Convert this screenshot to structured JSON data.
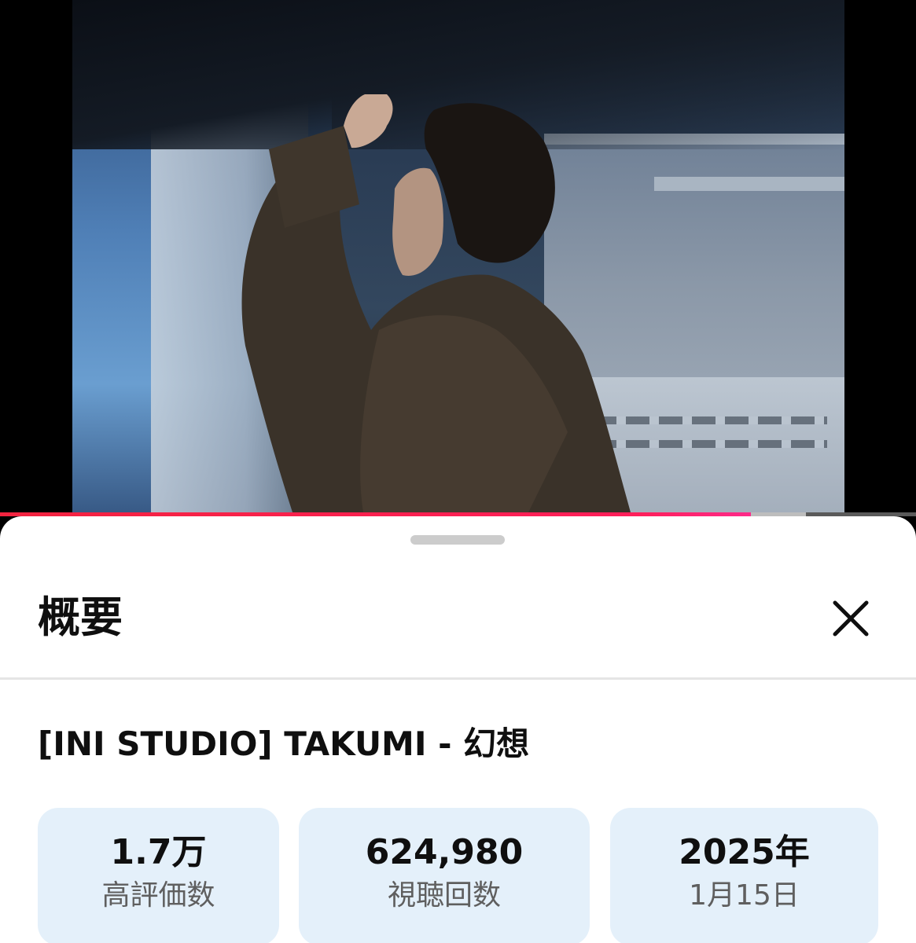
{
  "player": {
    "progress_fraction": 0.82,
    "buffered_fraction": 0.88,
    "progress_colors": [
      "#f2233f",
      "#ff2a8a"
    ]
  },
  "sheet": {
    "title": "概要",
    "close_icon": "close-icon",
    "video_title": "[INI STUDIO] TAKUMI - 幻想",
    "stats": [
      {
        "value": "1.7万",
        "label": "高評価数"
      },
      {
        "value": "624,980",
        "label": "視聴回数"
      },
      {
        "value": "2025年",
        "label": "1月15日"
      }
    ]
  },
  "colors": {
    "card_background": "#e4f0fa",
    "title_text": "#0f0f0f",
    "label_text": "#5f5f5f"
  }
}
